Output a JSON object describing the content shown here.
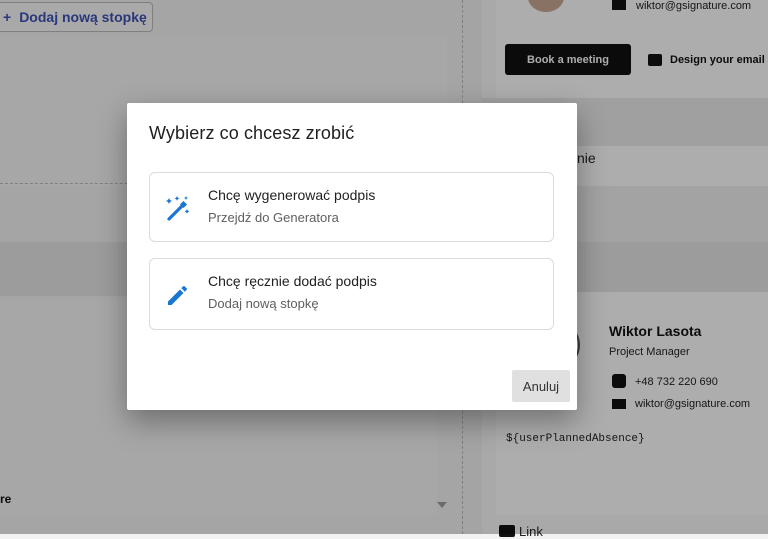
{
  "background": {
    "add_footer_label": "Dodaj nową stopkę",
    "add_footer_icon": "plus-icon",
    "left_label": "re",
    "top_email": "wiktor@gsignature.com",
    "book_meeting_label": "Book a meeting",
    "design_email_label": "Design your email",
    "partial_text": "nie",
    "signature": {
      "name": "Wiktor Lasota",
      "role": "Project Manager",
      "phone": "+48 732 220 690",
      "email": "wiktor@gsignature.com",
      "planned_absence": "${userPlannedAbsence}"
    },
    "link_label": "Link"
  },
  "dialog": {
    "title": "Wybierz co chcesz zrobić",
    "options": [
      {
        "title": "Chcę wygenerować podpis",
        "subtitle": "Przejdź do Generatora",
        "icon": "magic-wand-icon"
      },
      {
        "title": "Chcę ręcznie dodać podpis",
        "subtitle": "Dodaj nową stopkę",
        "icon": "pencil-icon"
      }
    ],
    "cancel_label": "Anuluj"
  },
  "colors": {
    "accent": "#1976d2",
    "overlay": "rgba(0,0,0,0.32)",
    "button_dark": "#111111"
  }
}
